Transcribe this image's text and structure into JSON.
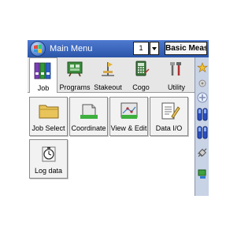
{
  "window": {
    "title": "Main Menu",
    "job_selector_value": "1",
    "basic_meas_label": "Basic Meas."
  },
  "tabs": [
    {
      "label": "Job",
      "icon": "binders-icon",
      "active": true
    },
    {
      "label": "Programs",
      "icon": "board-icon",
      "active": false
    },
    {
      "label": "Stakeout",
      "icon": "stakeout-icon",
      "active": false
    },
    {
      "label": "Cogo",
      "icon": "calculator-icon",
      "active": false
    },
    {
      "label": "Utility",
      "icon": "tools-icon",
      "active": false
    }
  ],
  "tiles": [
    {
      "label": "Job Select",
      "icon": "folder-icon"
    },
    {
      "label": "Coordinate",
      "icon": "box-grid-icon"
    },
    {
      "label": "View & Edit",
      "icon": "xyz-icon"
    },
    {
      "label": "Data I/O",
      "icon": "document-pencil-icon"
    },
    {
      "label": "Log data",
      "icon": "stopwatch-icon"
    }
  ],
  "colors": {
    "title_bar": "#2f5cb3",
    "tab_bar": "#e6e6e6",
    "right_bar": "#c9d3e6",
    "tile_background": "#f2f2f2"
  }
}
